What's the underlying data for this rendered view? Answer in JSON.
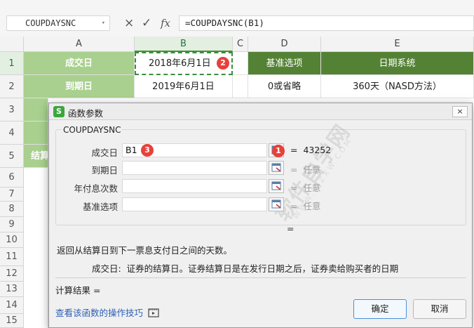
{
  "formula_bar": {
    "name_box": "COUPDAYSNC",
    "cancel_icon": "×",
    "enter_icon": "✓",
    "fx_icon": "fx",
    "formula": "=COUPDAYSNC(B1)"
  },
  "columns": [
    "A",
    "B",
    "C",
    "D",
    "E"
  ],
  "rows": [
    "1",
    "2",
    "3",
    "4",
    "5",
    "6",
    "7",
    "8",
    "9",
    "10",
    "11",
    "12",
    "13",
    "14",
    "15"
  ],
  "cells": {
    "a1": "成交日",
    "b1": "2018年6月1日",
    "d1": "基准选项",
    "e1": "日期系统",
    "a2": "到期日",
    "b2": "2019年6月1日",
    "d2": "0或省略",
    "e2": "360天（NASD方法）",
    "a5": "结算"
  },
  "badges": {
    "one": "1",
    "two": "2",
    "three": "3"
  },
  "dialog": {
    "title": "函数参数",
    "close_label": "×",
    "function_name": "COUPDAYSNC",
    "args": [
      {
        "label": "成交日",
        "value": "B1",
        "result": "43252"
      },
      {
        "label": "到期日",
        "value": "",
        "result": "任意"
      },
      {
        "label": "年付息次数",
        "value": "",
        "result": "任意"
      },
      {
        "label": "基准选项",
        "value": "",
        "result": "任意"
      }
    ],
    "eq": "=",
    "overall_eq": "=",
    "description": "返回从结算日到下一票息支付日之间的天数。",
    "arg_help_label": "成交日:",
    "arg_help_text": "证券的结算日。证券结算日是在发行日期之后，证券卖给购买者的日期",
    "calc_result_label": "计算结果 =",
    "help_link": "查看该函数的操作技巧",
    "ok_label": "确定",
    "cancel_label": "取消"
  },
  "watermark": {
    "main": "软件自学网",
    "sub": "WWW.RJZXW.COM"
  },
  "colors": {
    "header_green": "#548235",
    "label_green": "#a9d08e",
    "badge_red": "#e8403a"
  }
}
